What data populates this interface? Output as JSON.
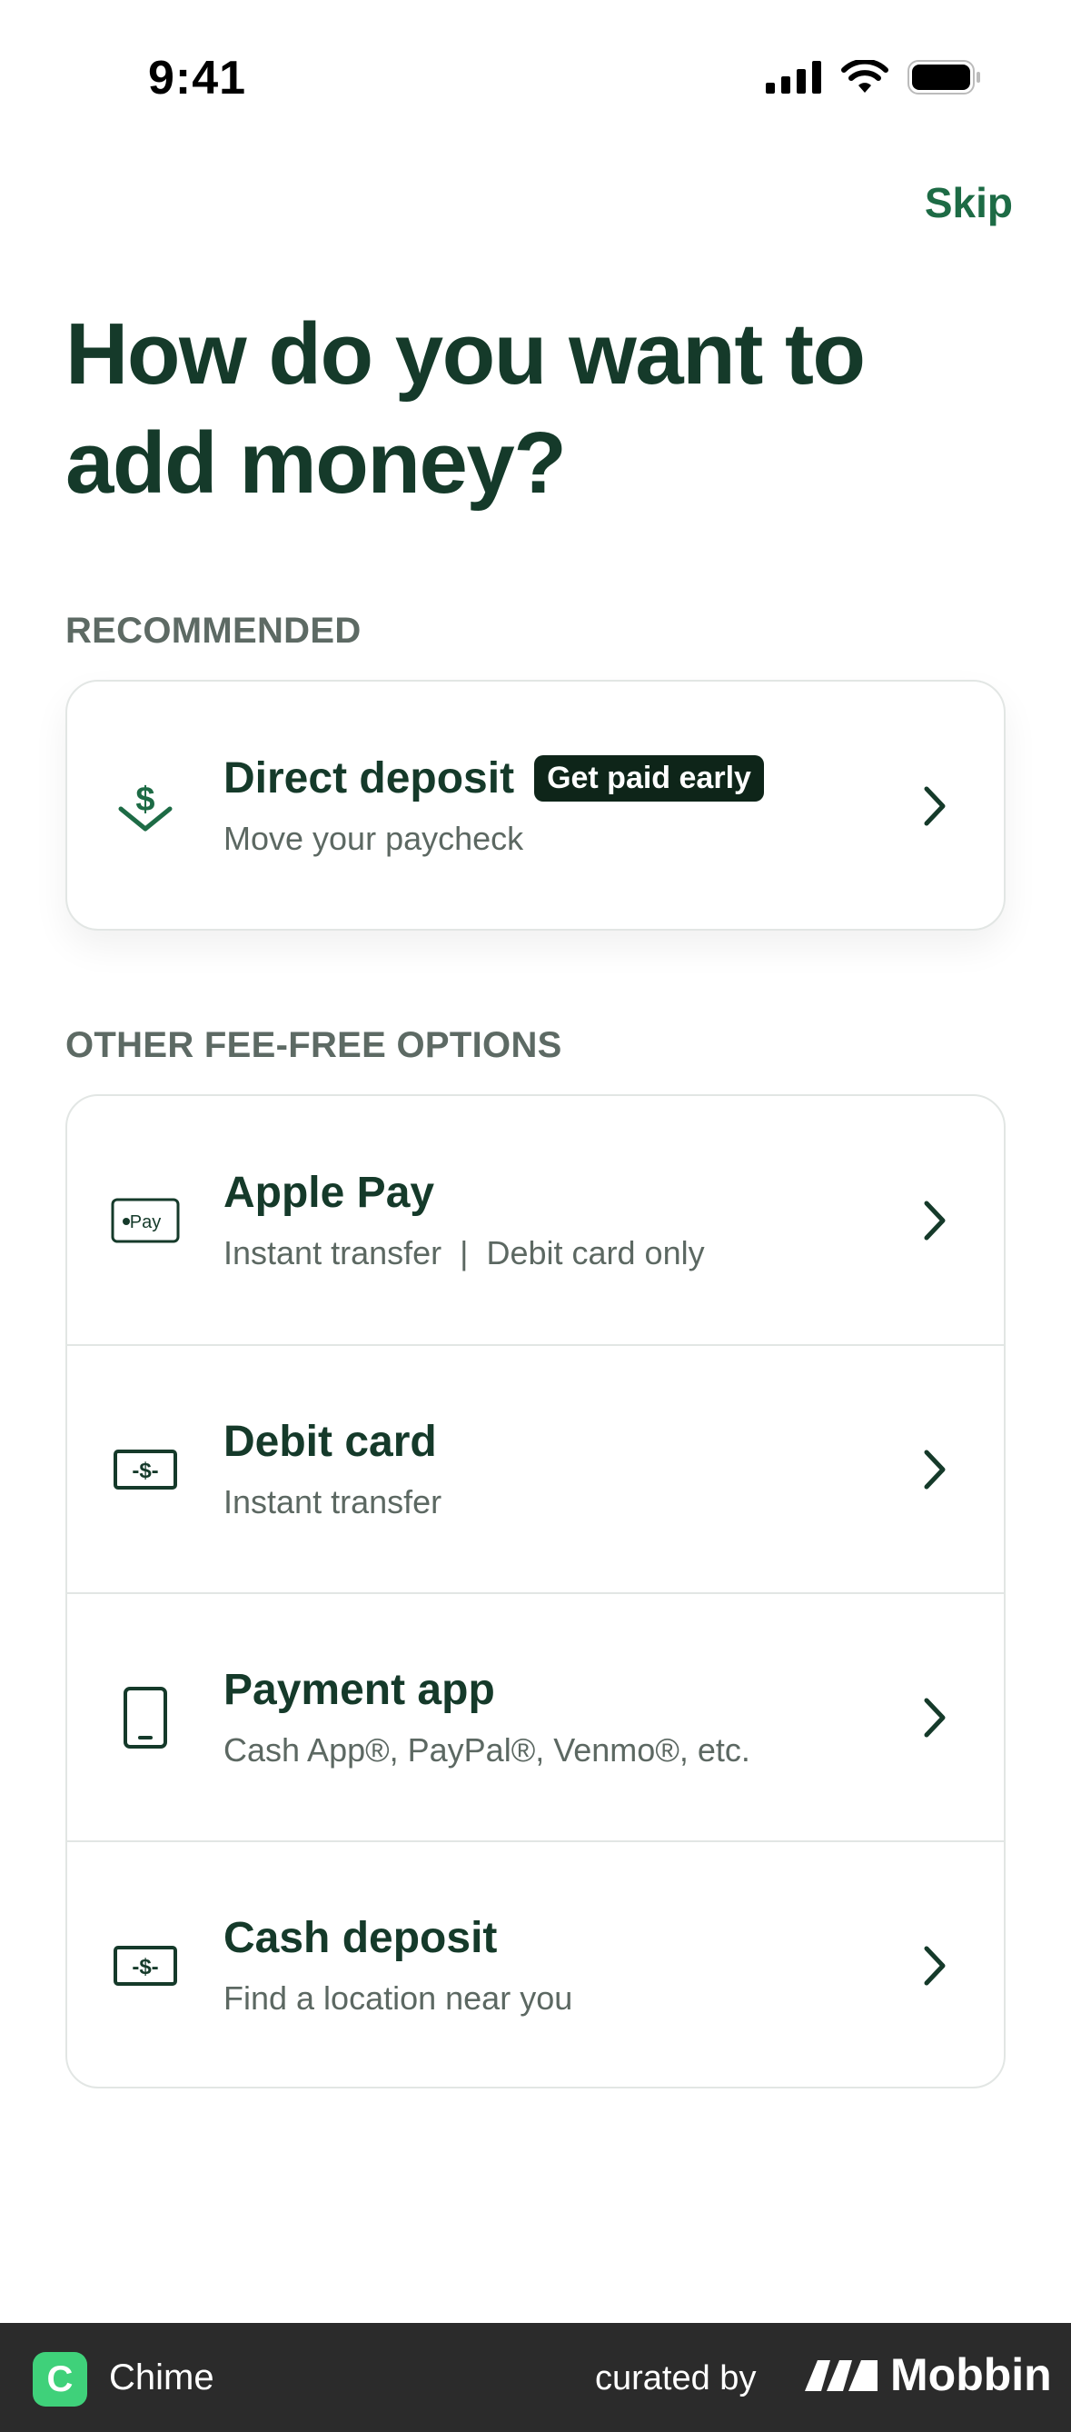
{
  "status_bar": {
    "time": "9:41"
  },
  "header": {
    "skip_label": "Skip"
  },
  "title": "How do you want to add money?",
  "recommended": {
    "section_label": "RECOMMENDED",
    "item": {
      "title": "Direct deposit",
      "badge": "Get paid early",
      "subtitle": "Move your paycheck",
      "icon": "dollar-deposit-icon"
    }
  },
  "other_options": {
    "section_label": "OTHER FEE-FREE OPTIONS",
    "items": [
      {
        "title": "Apple Pay",
        "subtitle": "Instant transfer  |  Debit card only",
        "icon": "apple-pay-icon"
      },
      {
        "title": "Debit card",
        "subtitle": "Instant transfer",
        "icon": "cash-bill-icon"
      },
      {
        "title": "Payment app",
        "subtitle": "Cash App®, PayPal®, Venmo®, etc.",
        "icon": "phone-icon"
      },
      {
        "title": "Cash deposit",
        "subtitle": "Find a location near you",
        "icon": "cash-bill-icon"
      }
    ]
  },
  "footer": {
    "app_letter": "C",
    "app_name": "Chime",
    "curated_label": "curated by",
    "brand": "Mobbin"
  },
  "colors": {
    "accent": "#1d6b45",
    "title": "#153a2a",
    "badge_bg": "#0e2519",
    "footer_bg": "#2b2b2b",
    "chime_green": "#3fd17a"
  }
}
